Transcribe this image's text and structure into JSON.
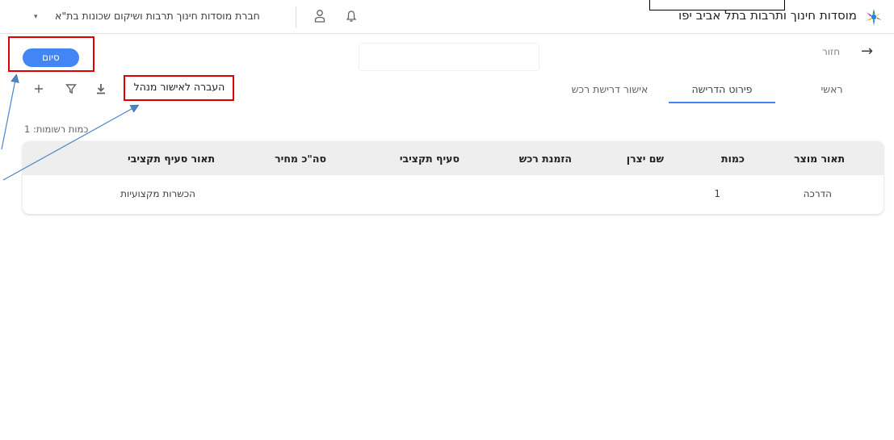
{
  "header": {
    "app_title": "מוסדות חינוך ותרבות בתל אביב יפו",
    "org_name": "חברת מוסדות חינוך תרבות ושיקום שכונות בת\"א",
    "org_caret": "▾"
  },
  "nav": {
    "back_label": "חזור",
    "back_arrow": "→"
  },
  "actions": {
    "finish_label": "סיום",
    "transfer_label": "העברה לאישור מנהל"
  },
  "tabs": [
    {
      "label": "ראשי",
      "active": false
    },
    {
      "label": "פירוט הדרישה",
      "active": true
    },
    {
      "label": "אישור דרישת רכש",
      "active": false
    }
  ],
  "records_count": "כמות רשומות: 1",
  "table": {
    "columns": [
      "תאור מוצר",
      "כמות",
      "שם יצרן",
      "הזמנת רכש",
      "סעיף תקציבי",
      "סה\"כ מחיר",
      "תאור סעיף תקציבי"
    ],
    "rows": [
      [
        "הדרכה",
        "1",
        "",
        "",
        "",
        "",
        "הכשרות מקצועיות"
      ]
    ]
  },
  "colors": {
    "accent": "#4285f4",
    "highlight": "#e00000",
    "arrow": "#4a86c8"
  },
  "icons": [
    "logo-icon",
    "bell-icon",
    "user-icon",
    "back-arrow-icon",
    "add-icon",
    "filter-icon",
    "download-icon"
  ]
}
